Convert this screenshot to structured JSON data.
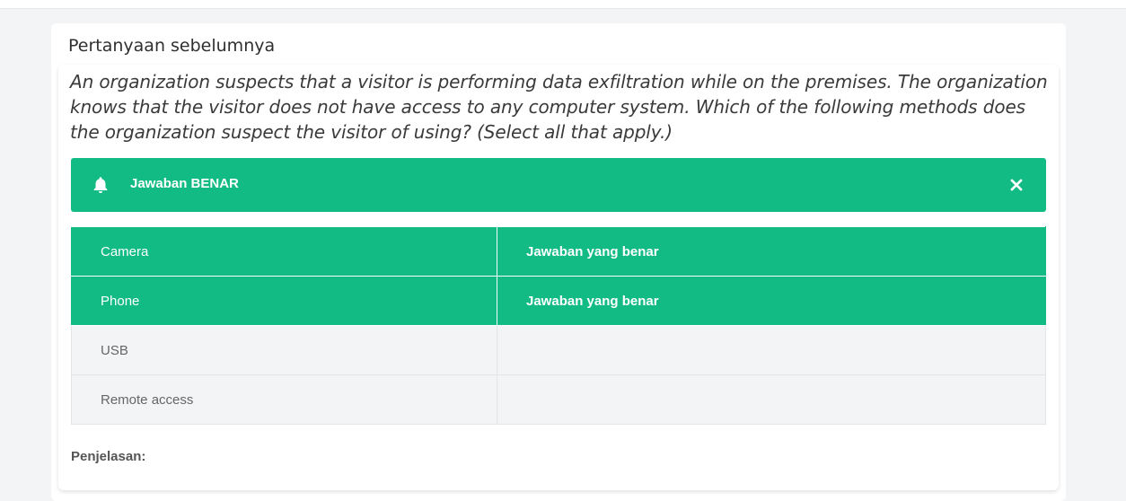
{
  "previous_question_label": "Pertanyaan sebelumnya",
  "question": "An organization suspects that a visitor is performing data exfiltration while on the premises. The organization knows that the visitor does not have access to any computer system. Which of the following methods does the organization suspect the visitor of using? (Select all that apply.)",
  "alert": {
    "text": "Jawaban BENAR",
    "icon": "bell-icon",
    "close_icon": "close-icon",
    "color": "#12bb83"
  },
  "options": [
    {
      "label": "Camera",
      "status": "Jawaban yang benar",
      "correct": true
    },
    {
      "label": "Phone",
      "status": "Jawaban yang benar",
      "correct": true
    },
    {
      "label": "USB",
      "status": "",
      "correct": false
    },
    {
      "label": "Remote access",
      "status": "",
      "correct": false
    }
  ],
  "explanation_label": "Penjelasan:"
}
